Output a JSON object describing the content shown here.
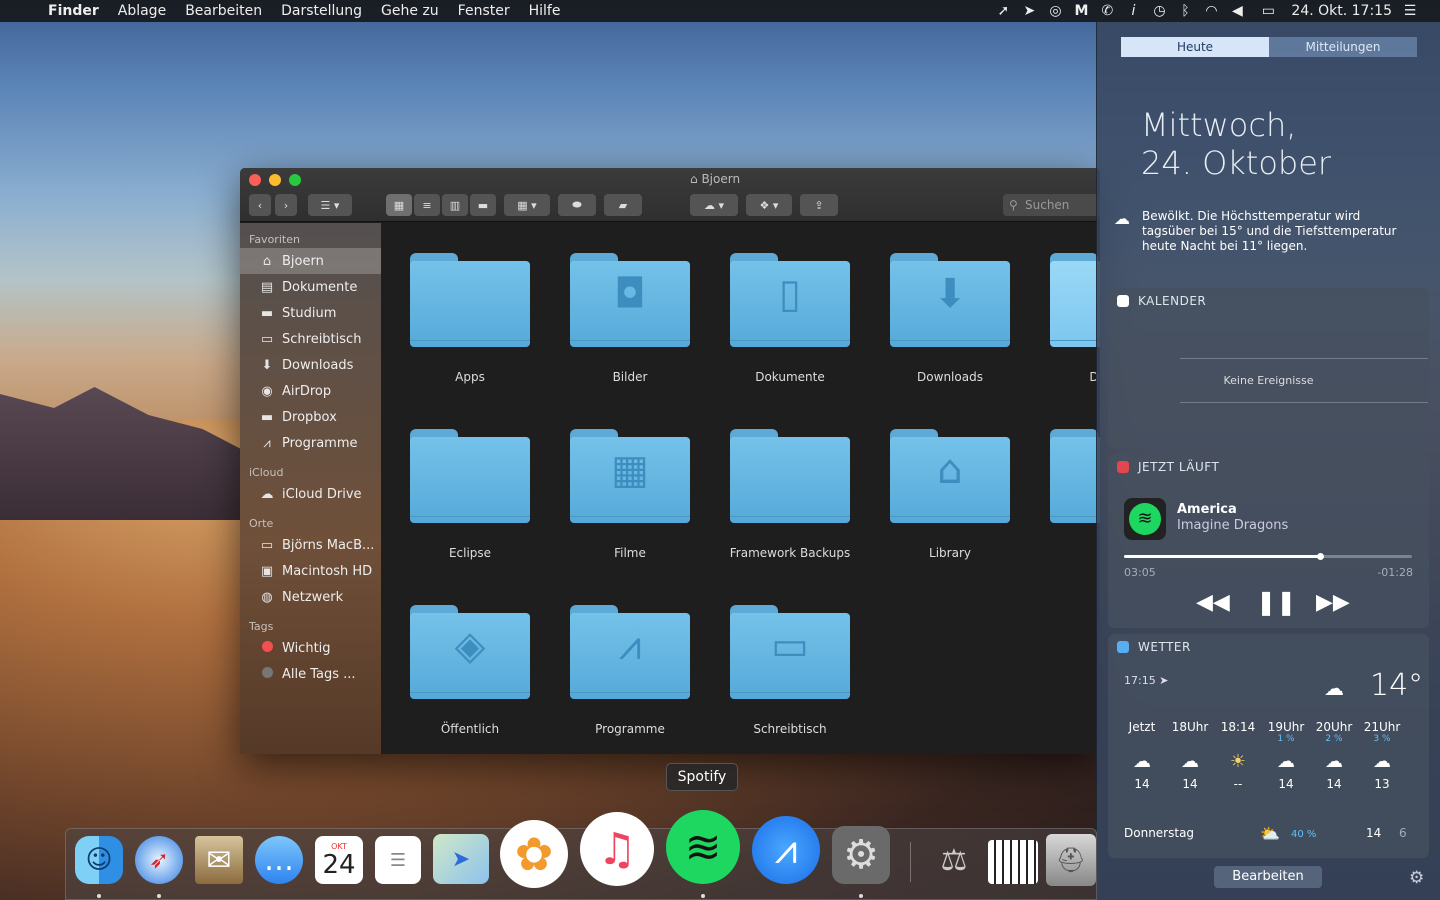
{
  "menubar": {
    "app": "Finder",
    "items": [
      "Ablage",
      "Bearbeiten",
      "Darstellung",
      "Gehe zu",
      "Fenster",
      "Hilfe"
    ],
    "clock": "24. Okt. 17:15"
  },
  "finder": {
    "title": "Bjoern",
    "search_placeholder": "Suchen",
    "sidebar": {
      "favorites_header": "Favoriten",
      "favorites": [
        "Bjoern",
        "Dokumente",
        "Studium",
        "Schreibtisch",
        "Downloads",
        "AirDrop",
        "Dropbox",
        "Programme"
      ],
      "icloud_header": "iCloud",
      "icloud": [
        "iCloud Drive"
      ],
      "places_header": "Orte",
      "places": [
        "Björns MacB...",
        "Macintosh HD",
        "Netzwerk"
      ],
      "tags_header": "Tags",
      "tags": [
        "Wichtig",
        "Alle Tags ..."
      ]
    },
    "folders": [
      "Apps",
      "Bilder",
      "Dokumente",
      "Downloads",
      "D",
      "Eclipse",
      "Filme",
      "Framework Backups",
      "Library",
      "Öffentlich",
      "Programme",
      "Schreibtisch"
    ]
  },
  "nc": {
    "tabs": [
      "Heute",
      "Mitteilungen"
    ],
    "date_line1": "Mittwoch,",
    "date_line2": "24. Oktober",
    "weather_summary": "Bewölkt. Die Höchsttemperatur wird tagsüber bei 15° und die Tiefsttemperatur heute Nacht bei 11° liegen.",
    "calendar": {
      "title": "KALENDER",
      "empty": "Keine Ereignisse"
    },
    "nowplaying": {
      "title": "JETZT LÄUFT",
      "track": "America",
      "artist": "Imagine Dragons",
      "elapsed": "03:05",
      "remaining": "-01:28",
      "progress": 0.68
    },
    "weather": {
      "title": "WETTER",
      "time": "17:15",
      "temp": "14°",
      "hours": [
        {
          "label": "Jetzt",
          "pct": "",
          "temp": "14"
        },
        {
          "label": "18Uhr",
          "pct": "",
          "temp": "14"
        },
        {
          "label": "18:14",
          "pct": "",
          "temp": "--"
        },
        {
          "label": "19Uhr",
          "pct": "1 %",
          "temp": "14"
        },
        {
          "label": "20Uhr",
          "pct": "2 %",
          "temp": "14"
        },
        {
          "label": "21Uhr",
          "pct": "3 %",
          "temp": "13"
        }
      ],
      "day": "Donnerstag",
      "day_pct": "40 %",
      "day_high": "14",
      "day_low": "6"
    },
    "edit_button": "Bearbeiten"
  },
  "dock": {
    "tooltip": "Spotify",
    "calendar_month": "OKT",
    "calendar_day": "24"
  },
  "colors": {
    "folder": "#6bb8e4",
    "tag_red": "#f0504f",
    "spotify": "#1ed760"
  }
}
